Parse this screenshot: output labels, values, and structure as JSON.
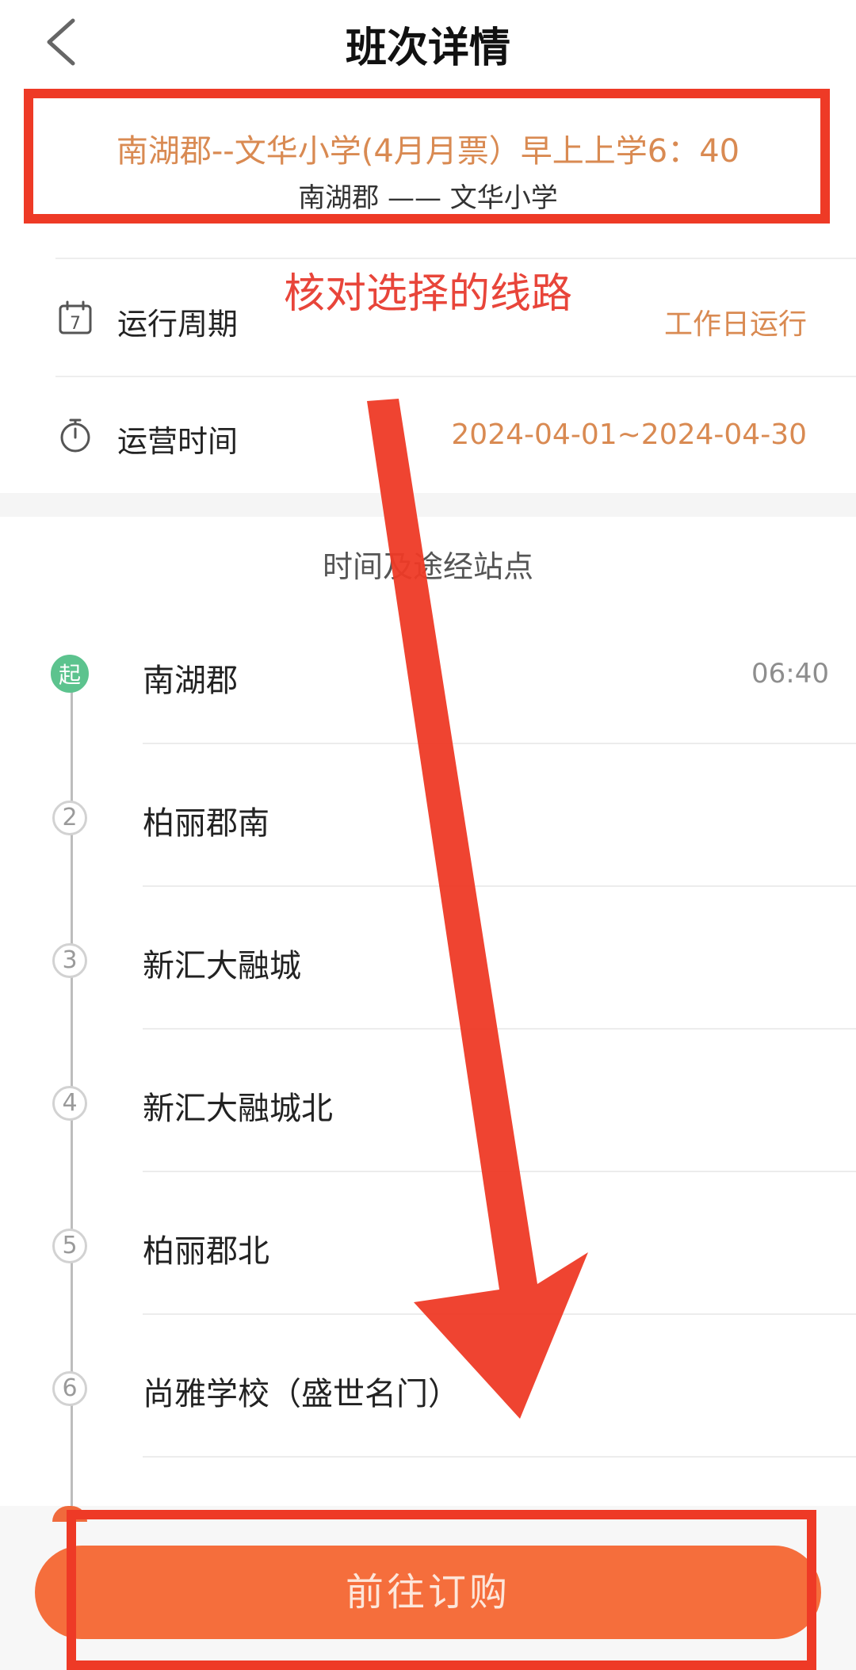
{
  "header": {
    "title": "班次详情"
  },
  "route": {
    "name": "南湖郡--文华小学(4月月票）早上上学6：40",
    "path": "南湖郡 —— 文华小学"
  },
  "annotation": {
    "text": "核对选择的线路"
  },
  "info": {
    "cycle_label": "运行周期",
    "cycle_value": "工作日运行",
    "cycle_icon_text": "7",
    "time_label": "运营时间",
    "time_value": "2024-04-01~2024-04-30"
  },
  "stops_section": {
    "title": "时间及途经站点",
    "stops": [
      {
        "marker": "起",
        "name": "南湖郡",
        "time": "06:40"
      },
      {
        "marker": "2",
        "name": "柏丽郡南",
        "time": ""
      },
      {
        "marker": "3",
        "name": "新汇大融城",
        "time": ""
      },
      {
        "marker": "4",
        "name": "新汇大融城北",
        "time": ""
      },
      {
        "marker": "5",
        "name": "柏丽郡北",
        "time": ""
      },
      {
        "marker": "6",
        "name": "尚雅学校（盛世名门）",
        "time": ""
      }
    ]
  },
  "footer": {
    "order_label": "前往订购"
  },
  "colors": {
    "accent": "#f56e3c",
    "highlight_red": "#ee3a26",
    "start_green": "#5cc38e",
    "value_orange": "#d98a52"
  }
}
